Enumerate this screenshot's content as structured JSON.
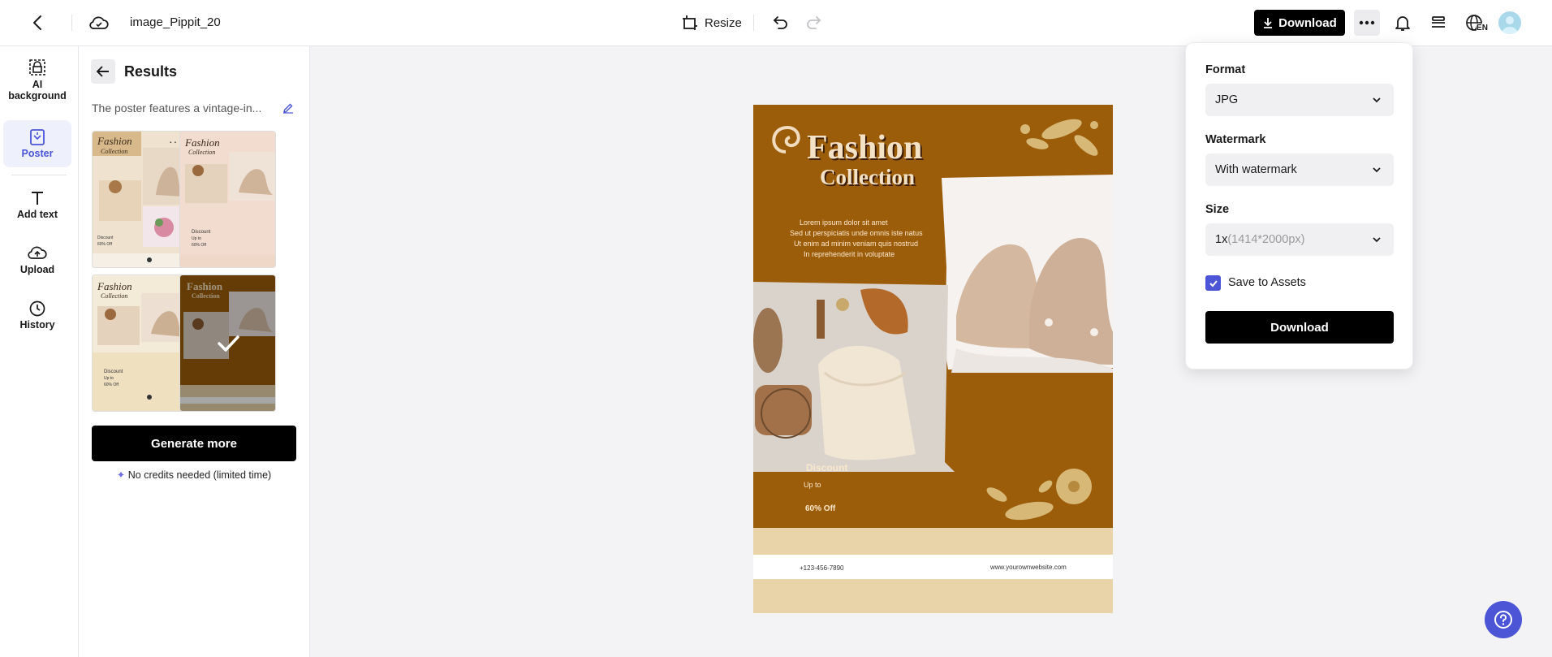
{
  "header": {
    "file_name": "image_Pippit_20",
    "resize_label": "Resize",
    "download_label": "Download",
    "language_code": "EN"
  },
  "leftnav": {
    "items": [
      {
        "label": "AI background",
        "icon": "ai-background-icon"
      },
      {
        "label": "Poster",
        "icon": "poster-icon",
        "active": true
      },
      {
        "label": "Add text",
        "icon": "text-icon"
      },
      {
        "label": "Upload",
        "icon": "upload-icon"
      },
      {
        "label": "History",
        "icon": "history-icon"
      }
    ]
  },
  "panel": {
    "title": "Results",
    "description": "The poster features a vintage-in...",
    "generate_label": "Generate more",
    "credit_note": "No credits needed (limited time)"
  },
  "poster": {
    "title_line1": "Fashion",
    "title_line2": "Collection",
    "body_lines": [
      "Lorem ipsum dolor sit amet",
      "Sed ut perspiciatis unde omnis iste natus",
      "Ut enim ad minim veniam quis nostrud",
      "In reprehenderit in voluptate"
    ],
    "discount": "Discount",
    "upto": "Up to",
    "percent": "60% Off",
    "phone": "+123-456-7890",
    "website": "www.yourownwebsite.com"
  },
  "download_panel": {
    "format_label": "Format",
    "format_value": "JPG",
    "watermark_label": "Watermark",
    "watermark_value": "With watermark",
    "size_label": "Size",
    "size_value": "1x",
    "size_detail": "(1414*2000px)",
    "save_assets_label": "Save to Assets",
    "save_assets_checked": true,
    "download_label": "Download"
  },
  "colors": {
    "accent": "#4b55d6",
    "poster_brown": "#9c5d0a",
    "poster_cream": "#e9d3a8"
  }
}
